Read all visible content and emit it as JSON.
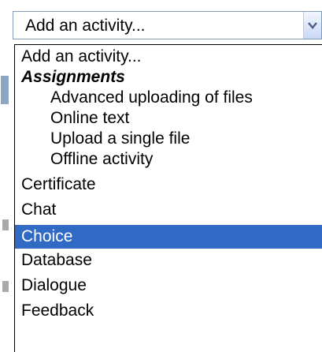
{
  "select": {
    "value": "Add an activity..."
  },
  "dropdown": {
    "items": [
      {
        "label": "Add an activity...",
        "type": "option"
      },
      {
        "label": "Assignments",
        "type": "group"
      },
      {
        "label": "Advanced uploading of files",
        "type": "sub"
      },
      {
        "label": "Online text",
        "type": "sub"
      },
      {
        "label": "Upload a single file",
        "type": "sub"
      },
      {
        "label": "Offline activity",
        "type": "sub"
      },
      {
        "label": "Certificate",
        "type": "option"
      },
      {
        "label": "Chat",
        "type": "option"
      },
      {
        "label": "Choice",
        "type": "option",
        "selected": true
      },
      {
        "label": "Database",
        "type": "option"
      },
      {
        "label": "Dialogue",
        "type": "option"
      },
      {
        "label": "Feedback",
        "type": "option"
      }
    ]
  },
  "colors": {
    "highlight": "#316ac5",
    "border": "#7f9db9"
  }
}
